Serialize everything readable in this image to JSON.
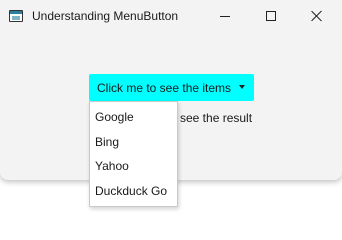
{
  "window": {
    "title": "Understanding MenuButton",
    "controls": [
      "minimize-icon",
      "maximize-icon",
      "close-icon"
    ]
  },
  "menu_button": {
    "label": "Click me to see the items",
    "color": "#00ffff",
    "icon": "chevron-down-icon"
  },
  "result_label": "see the result",
  "dropdown": {
    "items": [
      "Google",
      "Bing",
      "Yahoo",
      "Duckduck Go"
    ]
  }
}
